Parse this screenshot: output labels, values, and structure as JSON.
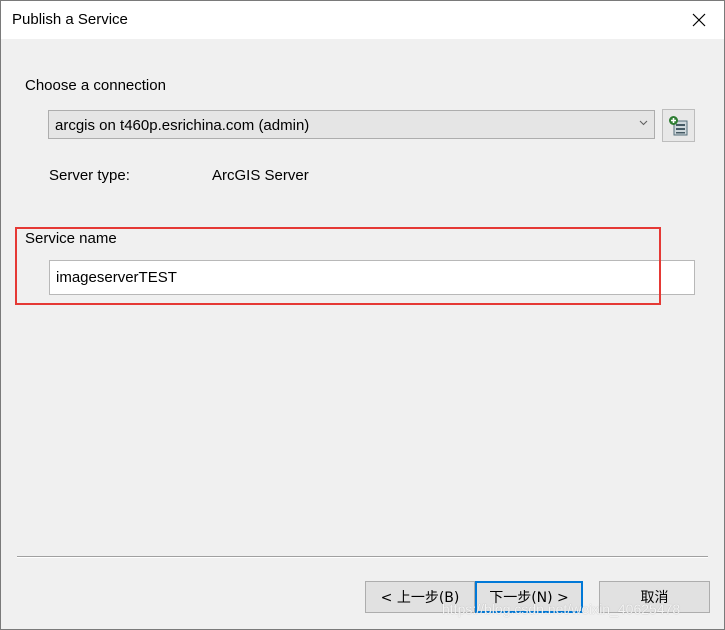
{
  "window": {
    "title": "Publish a Service"
  },
  "connection": {
    "heading": "Choose a connection",
    "selected": "arcgis on t460p.esrichina.com (admin)",
    "server_type_label": "Server type:",
    "server_type_value": "ArcGIS Server"
  },
  "service": {
    "name_label": "Service name",
    "name_value": "imageserverTEST"
  },
  "buttons": {
    "back": "< 上一步(B)",
    "next": "下一步(N) >",
    "cancel": "取消"
  },
  "watermark": "https://blog.csdn.net/weixin_40625478",
  "colors": {
    "highlight": "#e53935",
    "default_button_border": "#0078d7"
  },
  "icons": {
    "close": "close-icon",
    "dropdown": "chevron-down-icon",
    "add_connection": "add-server-connection-icon"
  }
}
